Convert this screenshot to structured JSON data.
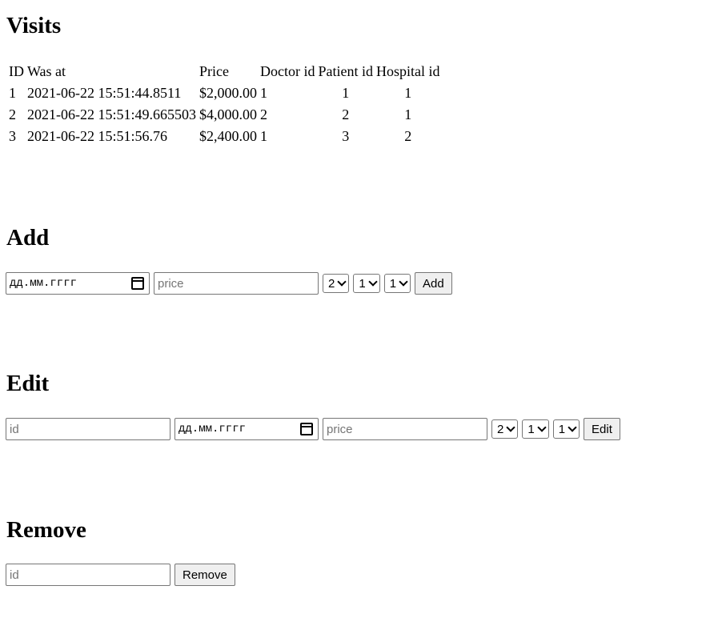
{
  "visits": {
    "title": "Visits",
    "columns": [
      "ID",
      "Was at",
      "Price",
      "Doctor id",
      "Patient id",
      "Hospital id"
    ],
    "rows": [
      [
        "1",
        "2021-06-22 15:51:44.8511",
        "$2,000.00",
        "1",
        "1",
        "1"
      ],
      [
        "2",
        "2021-06-22 15:51:49.665503",
        "$4,000.00",
        "2",
        "2",
        "1"
      ],
      [
        "3",
        "2021-06-22 15:51:56.76",
        "$2,400.00",
        "1",
        "3",
        "2"
      ]
    ]
  },
  "add": {
    "title": "Add",
    "date_placeholder": "дд.мм.гггг",
    "price_placeholder": "price",
    "doctor_select": "2",
    "patient_select": "1",
    "hospital_select": "1",
    "button_label": "Add"
  },
  "edit": {
    "title": "Edit",
    "id_placeholder": "id",
    "date_placeholder": "дд.мм.гггг",
    "price_placeholder": "price",
    "doctor_select": "2",
    "patient_select": "1",
    "hospital_select": "1",
    "button_label": "Edit"
  },
  "remove": {
    "title": "Remove",
    "id_placeholder": "id",
    "button_label": "Remove"
  },
  "icons": {
    "date": "calendar-icon",
    "select": "chevron-down-icon"
  }
}
